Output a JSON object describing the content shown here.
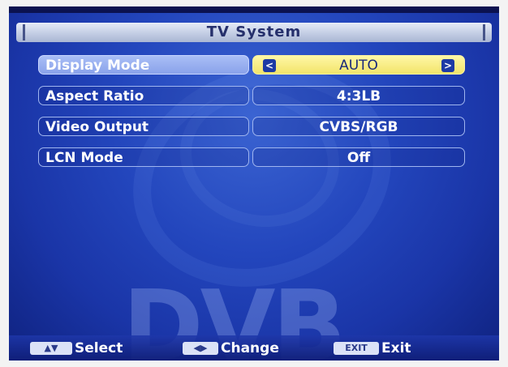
{
  "title": "TV System",
  "rows": [
    {
      "label": "Display Mode",
      "value": "AUTO",
      "selected": true
    },
    {
      "label": "Aspect Ratio",
      "value": "4:3LB"
    },
    {
      "label": "Video Output",
      "value": "CVBS/RGB"
    },
    {
      "label": "LCN Mode",
      "value": "Off"
    }
  ],
  "watermark": "DVB",
  "hints": [
    {
      "key": "▲▼",
      "label": "Select"
    },
    {
      "key": "◀▶",
      "label": "Change"
    },
    {
      "key": "EXIT",
      "label": "Exit"
    }
  ],
  "arrows": {
    "left": "<",
    "right": ">"
  },
  "colors": {
    "highlight": "#f2e46a",
    "background": "#2346bd"
  }
}
